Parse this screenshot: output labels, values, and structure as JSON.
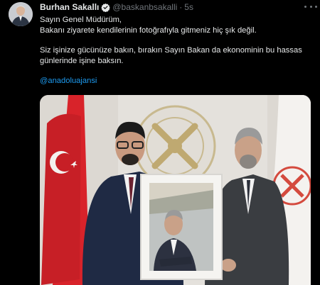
{
  "tweet": {
    "author_name": "Burhan Sakallı",
    "handle": "@baskanbsakalli",
    "separator": "·",
    "time": "5s",
    "lines": [
      "Sayın Genel Müdürüm,",
      "Bakanı ziyarete kendilerinin fotoğrafıyla gitmeniz hiç şık değil.",
      "Siz işinize gücünüze bakın, bırakın Sayın Bakan da ekonominin bu hassas",
      "günlerinde işine baksın."
    ],
    "mention": "@anadoluajansi"
  },
  "icons": {
    "verified": "verified-badge-icon",
    "more": "more-options-icon"
  },
  "colors": {
    "background": "#000000",
    "text": "#e7e9ea",
    "secondary_text": "#71767b",
    "link": "#1d9bf0",
    "flag_red": "#d8232a"
  }
}
